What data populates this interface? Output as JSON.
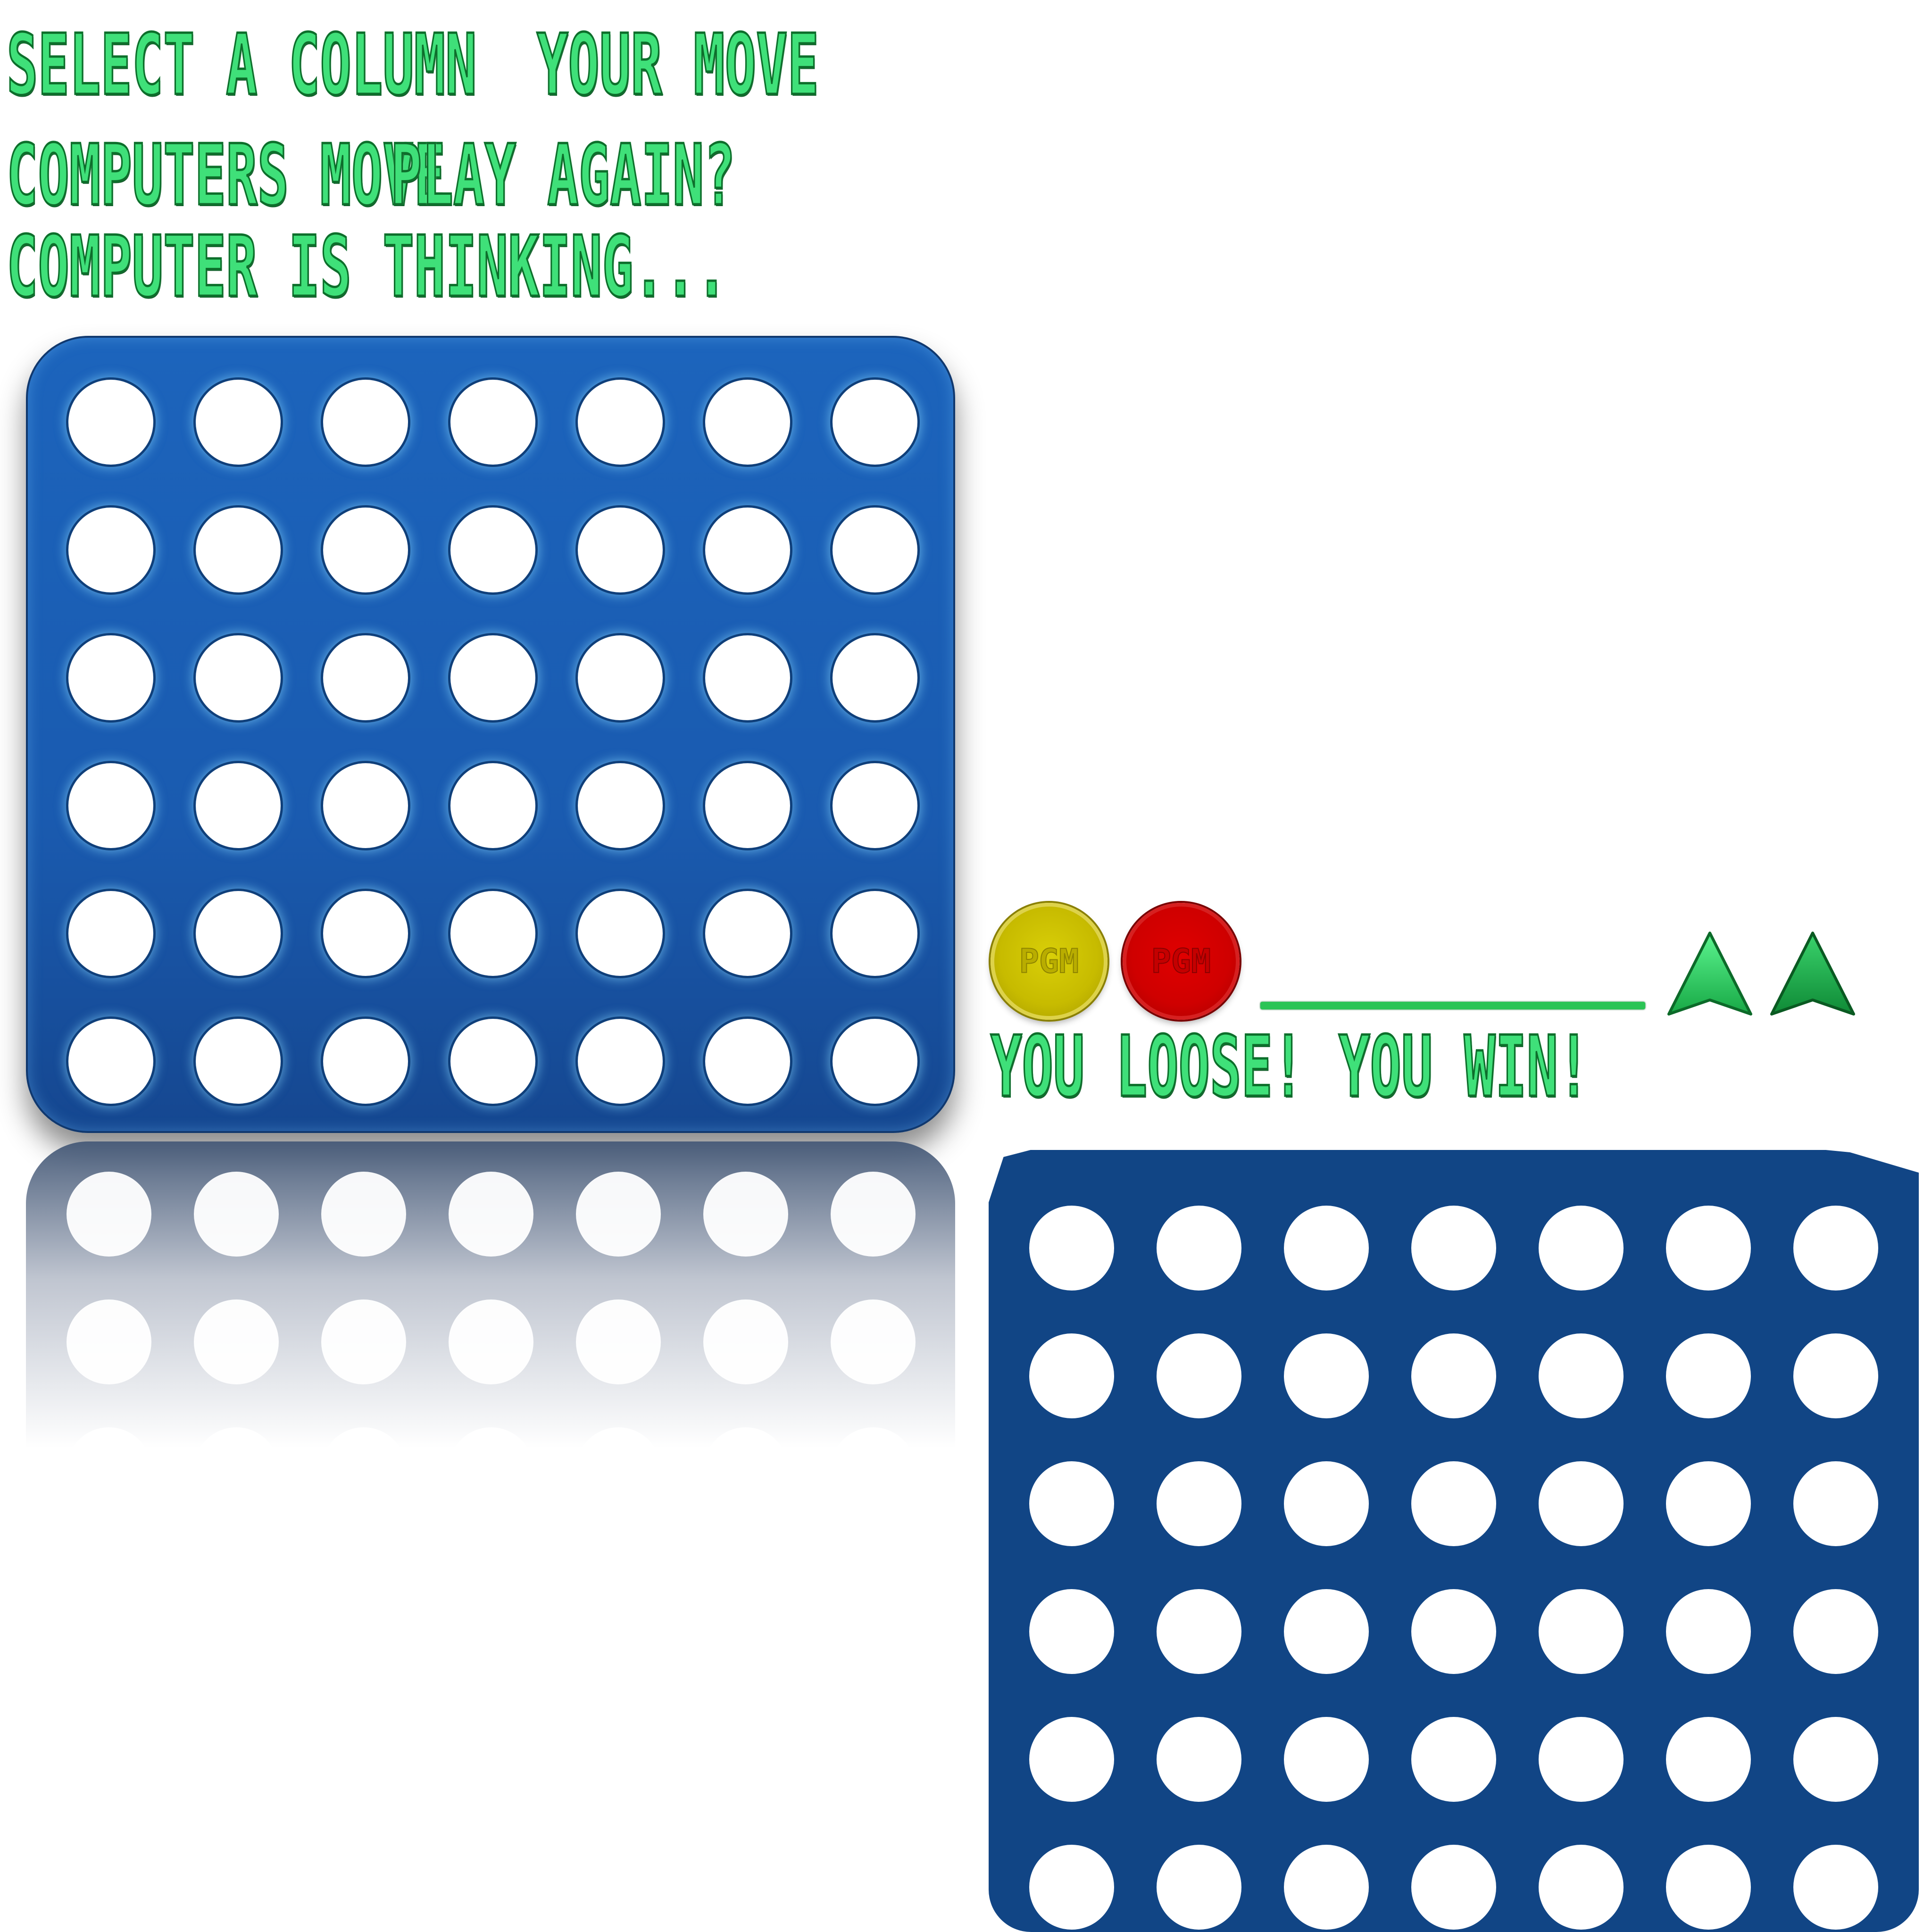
{
  "labels": {
    "select_column": "Select a Column",
    "your_move": "Your Move",
    "computers_move": "Computers Move",
    "play_again": "Play Again?",
    "computer_thinking": "Computer Is Thinking...",
    "you_loose": "You Loose!",
    "you_win": "You Win!"
  },
  "board": {
    "columns": 7,
    "rows": 6,
    "color": "#1a5bb0",
    "hole_color": "#ffffff"
  },
  "board_alt": {
    "columns": 7,
    "rows": 6,
    "color": "#114585"
  },
  "reflection": {
    "visible_rows": 3
  },
  "chips": {
    "yellow": {
      "color": "#c7bb00",
      "mark": "PGM"
    },
    "red": {
      "color": "#cf0000",
      "mark": "PGM"
    }
  },
  "accent_color": "#3fe079",
  "icons": [
    "column-arrow-icon",
    "column-arrow-icon"
  ]
}
